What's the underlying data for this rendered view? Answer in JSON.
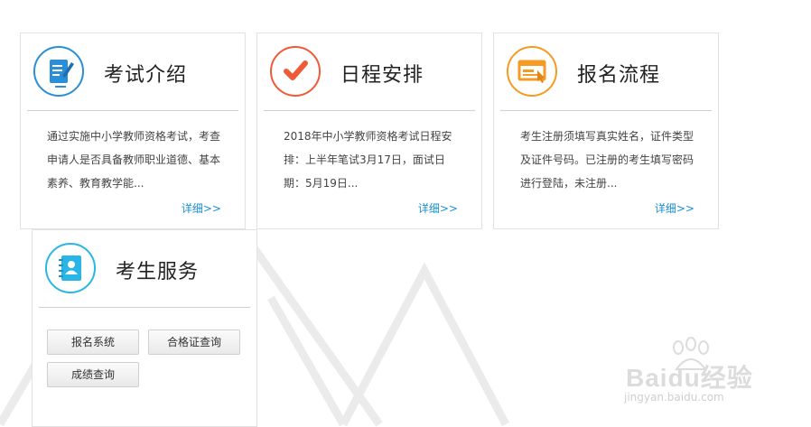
{
  "cards": [
    {
      "title": "考试介绍",
      "desc": "通过实施中小学教师资格考试，考查申请人是否具备教师职业道德、基本素养、教育教学能...",
      "more": "详细>>",
      "icon": "document-edit-icon",
      "color": "#2a8fd6"
    },
    {
      "title": "日程安排",
      "desc": "2018年中小学教师资格考试日程安排：上半年笔试3月17日，面试日期：5月19日...",
      "more": "详细>>",
      "icon": "checkmark-icon",
      "color": "#f05a36"
    },
    {
      "title": "报名流程",
      "desc": "考生注册须填写真实姓名，证件类型及证件号码。已注册的考生填写密码进行登陆，未注册...",
      "more": "详细>>",
      "icon": "browser-window-icon",
      "color": "#f59a23"
    }
  ],
  "service": {
    "title": "考生服务",
    "icon": "contact-book-icon",
    "color": "#29b6e6",
    "buttons": [
      "报名系统",
      "合格证查询",
      "成绩查询"
    ]
  },
  "watermark": {
    "main": "Baidu经验",
    "sub": "jingyan.baidu.com"
  }
}
